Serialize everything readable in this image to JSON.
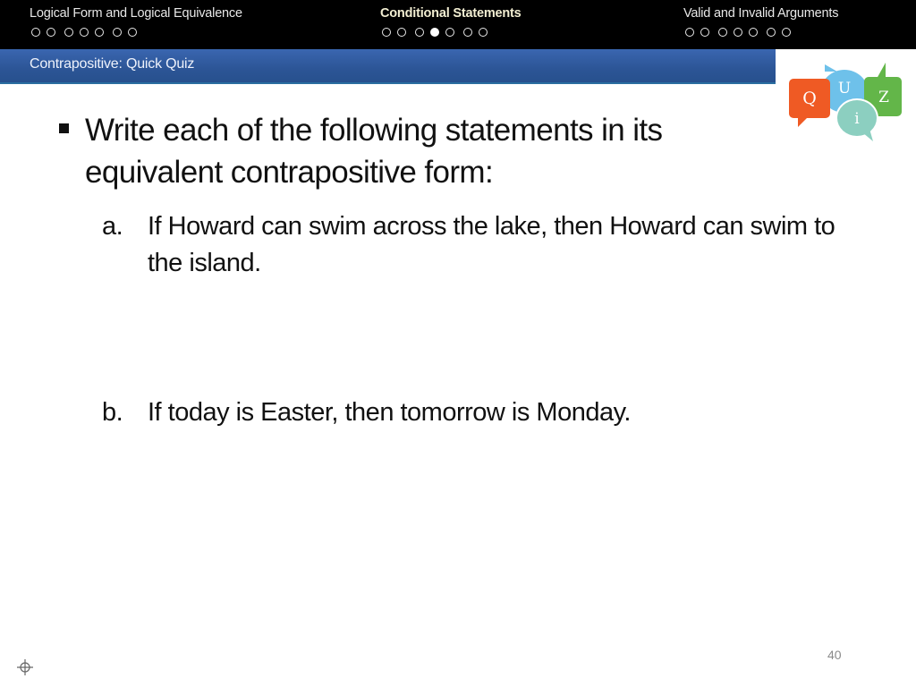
{
  "nav": {
    "sections": [
      {
        "title": "Logical Form and Logical Equivalence",
        "active": false,
        "dots": 7,
        "filled_index": -1
      },
      {
        "title": "Conditional Statements",
        "active": true,
        "dots": 7,
        "filled_index": 3
      },
      {
        "title": "Valid and Invalid Arguments",
        "active": false,
        "dots": 7,
        "filled_index": -1
      }
    ]
  },
  "header": {
    "subtitle": "Contrapositive: Quick Quiz"
  },
  "logo": {
    "letters": [
      "Q",
      "U",
      "i",
      "Z"
    ],
    "colors": {
      "Q": "#ef5a24",
      "U": "#6ec1ea",
      "i": "#8ccfc0",
      "Z": "#63b649"
    }
  },
  "body": {
    "bullet": "Write each of the following statements in its equivalent contrapositive form:",
    "items": [
      {
        "label": "a.",
        "text": "If Howard can swim across the lake, then Howard can swim to the island."
      },
      {
        "label": "b.",
        "text": "If today is Easter, then tomorrow is Monday."
      }
    ]
  },
  "footer": {
    "page_number": "40"
  }
}
